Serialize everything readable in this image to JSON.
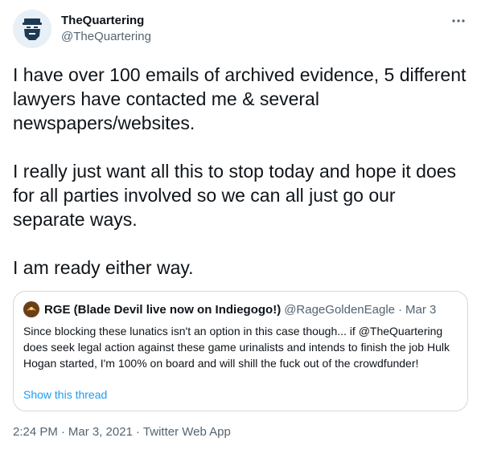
{
  "author": {
    "display_name": "TheQuartering",
    "handle": "@TheQuartering",
    "avatar_icon": "bearded-man-avatar-icon",
    "more_icon": "more-horizontal-icon"
  },
  "tweet": {
    "paragraphs": [
      "I have over 100 emails of archived evidence, 5 different lawyers have contacted me & several newspapers/websites.",
      "I really just want all this to stop today and hope it does for all parties involved so we can all just go our separate ways.",
      "I am ready either way."
    ]
  },
  "quote": {
    "display_name": "RGE (Blade Devil live now on Indiegogo!)",
    "handle": "@RageGoldenEagle",
    "separator": "·",
    "date": "Mar 3",
    "text": "Since blocking these lunatics isn't an option in this case though... if @TheQuartering does seek legal action against these game urinalists and intends to finish the job Hulk Hogan started, I'm 100% on board and will shill the fuck out of the crowdfunder!",
    "show_thread": "Show this thread"
  },
  "meta": {
    "time": "2:24 PM",
    "date": "Mar 3, 2021",
    "separator": "·",
    "app": "Twitter Web App"
  },
  "colors": {
    "text": "#0f1419",
    "secondary": "#536471",
    "link": "#1d9bf0",
    "border": "#cfd9de"
  }
}
